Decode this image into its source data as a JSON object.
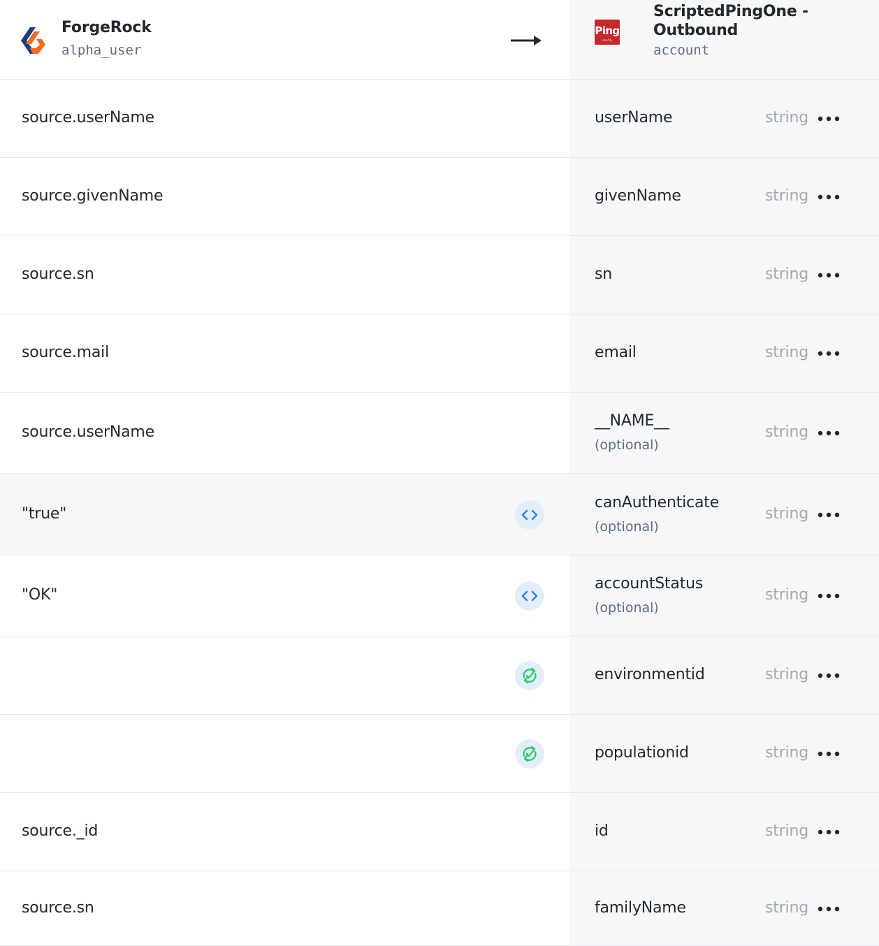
{
  "source": {
    "title": "ForgeRock",
    "object": "alpha_user"
  },
  "target": {
    "title": "ScriptedPingOne - Outbound",
    "object": "account",
    "logo_text": "Ping",
    "logo_subtext": "identity"
  },
  "colors": {
    "ping_red": "#c6282e",
    "script_icon": "#2f80ed",
    "sync_icon": "#2ecc71",
    "type_text": "#a1a8b2"
  },
  "mappings": [
    {
      "source": "source.userName",
      "target": "userName",
      "optional": "",
      "type": "string",
      "icon": ""
    },
    {
      "source": "source.givenName",
      "target": "givenName",
      "optional": "",
      "type": "string",
      "icon": ""
    },
    {
      "source": "source.sn",
      "target": "sn",
      "optional": "",
      "type": "string",
      "icon": ""
    },
    {
      "source": "source.mail",
      "target": "email",
      "optional": "",
      "type": "string",
      "icon": ""
    },
    {
      "source": "source.userName",
      "target": "__NAME__",
      "optional": "(optional)",
      "type": "string",
      "icon": ""
    },
    {
      "source": "\"true\"",
      "target": "canAuthenticate",
      "optional": "(optional)",
      "type": "string",
      "icon": "code-icon"
    },
    {
      "source": "\"OK\"",
      "target": "accountStatus",
      "optional": "(optional)",
      "type": "string",
      "icon": "code-icon"
    },
    {
      "source": "",
      "target": "environmentid",
      "optional": "",
      "type": "string",
      "icon": "sync-icon"
    },
    {
      "source": "",
      "target": "populationid",
      "optional": "",
      "type": "string",
      "icon": "sync-icon"
    },
    {
      "source": "source._id",
      "target": "id",
      "optional": "",
      "type": "string",
      "icon": ""
    },
    {
      "source": "source.sn",
      "target": "familyName",
      "optional": "",
      "type": "string",
      "icon": ""
    }
  ]
}
